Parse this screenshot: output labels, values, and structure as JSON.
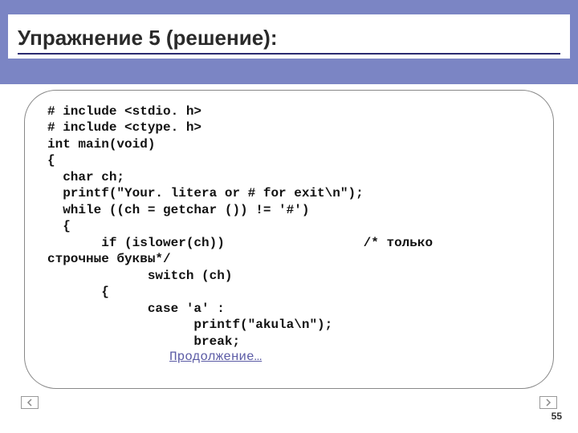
{
  "title": "Упражнение 5 (решение):",
  "code_lines": [
    "# include <stdio. h>",
    "# include <ctype. h>",
    "int main(void)",
    "{",
    "  char ch;",
    "  printf(\"Your. litera or # for exit\\n\");",
    "  while ((ch = getchar ()) != '#')",
    "  {",
    "       if (islower(ch))                  /* только",
    "строчные буквы*/",
    "             switch (ch)",
    "       {",
    "             case 'a' :",
    "                   printf(\"akula\\n\");",
    "                   break;"
  ],
  "continue_text": "Продолжение…",
  "page_number": "55"
}
